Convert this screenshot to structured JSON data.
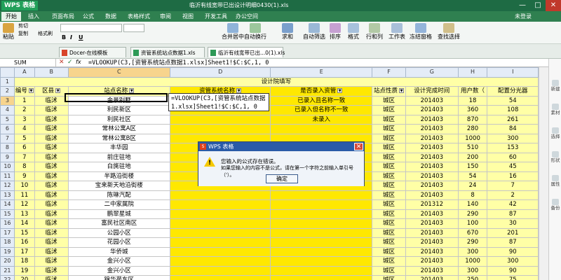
{
  "titlebar": {
    "app": "WPS 表格",
    "title": "临沂有线宽带已出设计明细0430(1).xls",
    "min": "—",
    "max": "□",
    "close": "✕"
  },
  "menubar": {
    "items": [
      "开始",
      "插入",
      "页面布局",
      "公式",
      "数据",
      "表格样式",
      "审阅",
      "视图",
      "开发工具",
      "办公空间"
    ],
    "active": 0,
    "login": "未登录"
  },
  "ribbon": {
    "paste": "粘贴",
    "cut": "剪切",
    "copy": "复制",
    "format_painter": "格式刷",
    "font": "",
    "size": "",
    "bold": "B",
    "italic": "I",
    "underline": "U",
    "merge": "合并居中",
    "wrap": "自动换行",
    "sum": "求和",
    "filter": "自动筛选",
    "sort": "排序",
    "format": "格式",
    "rowcol": "行和列",
    "sheet": "工作表",
    "freeze": "冻结窗格",
    "find": "查找选择"
  },
  "tabs": [
    {
      "label": "Docer-在线模板"
    },
    {
      "label": "资管系统站点数据1.xls"
    },
    {
      "label": "临沂有线宽带已出...0(1).xls"
    }
  ],
  "formula_bar": {
    "name": "SUM",
    "cancel": "✕",
    "ok": "✓",
    "fx": "fx",
    "formula": "=VLOOKUP(C3,[资管系统站点数据1.xlsx]Sheet1!$C:$C,1, 0"
  },
  "columns": [
    "A",
    "B",
    "C",
    "D",
    "E",
    "F",
    "G",
    "H",
    "I"
  ],
  "row1_header": "设计院填写",
  "header_row": [
    "编号",
    "区县",
    "站点名称",
    "资管系统名称",
    "是否录入资管",
    "站点性质",
    "设计完成时间",
    "用户数（",
    "配置分光器"
  ],
  "rows": [
    {
      "n": "3",
      "a": "1",
      "b": "临沭",
      "c": "金景别墅",
      "e": "已录入且名称一致",
      "f": "城区",
      "g": "201403",
      "h": "18",
      "i": "54"
    },
    {
      "n": "4",
      "a": "2",
      "b": "临沭",
      "c": "利民新区",
      "e": "已录入但名称不一致",
      "f": "城区",
      "g": "201403",
      "h": "360",
      "i": "108"
    },
    {
      "n": "5",
      "a": "3",
      "b": "临沭",
      "c": "利民社区",
      "e": "未录入",
      "f": "城区",
      "g": "201403",
      "h": "870",
      "i": "261"
    },
    {
      "n": "6",
      "a": "4",
      "b": "临沭",
      "c": "常林公寓A区",
      "e": "",
      "f": "城区",
      "g": "201403",
      "h": "280",
      "i": "84"
    },
    {
      "n": "7",
      "a": "5",
      "b": "临沭",
      "c": "常林公寓B区",
      "e": "",
      "f": "城区",
      "g": "201403",
      "h": "1000",
      "i": "300"
    },
    {
      "n": "8",
      "a": "6",
      "b": "临沭",
      "c": "丰华园",
      "e": "",
      "f": "城区",
      "g": "201403",
      "h": "510",
      "i": "153"
    },
    {
      "n": "9",
      "a": "7",
      "b": "临沭",
      "c": "前庄驻地",
      "e": "",
      "f": "城区",
      "g": "201403",
      "h": "200",
      "i": "60"
    },
    {
      "n": "10",
      "a": "8",
      "b": "临沭",
      "c": "白旄驻地",
      "e": "",
      "f": "城区",
      "g": "201403",
      "h": "150",
      "i": "45"
    },
    {
      "n": "11",
      "a": "9",
      "b": "临沭",
      "c": "半路沿街楼",
      "e": "",
      "f": "城区",
      "g": "201403",
      "h": "54",
      "i": "16"
    },
    {
      "n": "12",
      "a": "10",
      "b": "临沭",
      "c": "宝来新天地沿街楼",
      "e": "",
      "f": "城区",
      "g": "201403",
      "h": "24",
      "i": "7"
    },
    {
      "n": "13",
      "a": "11",
      "b": "临沭",
      "c": "陈琳汽配",
      "e": "",
      "f": "城区",
      "g": "201403",
      "h": "8",
      "i": "2"
    },
    {
      "n": "14",
      "a": "12",
      "b": "临沭",
      "c": "二中家属院",
      "e": "",
      "f": "城区",
      "g": "201312",
      "h": "140",
      "i": "42"
    },
    {
      "n": "15",
      "a": "13",
      "b": "临沭",
      "c": "鹏翠星城",
      "e": "",
      "f": "城区",
      "g": "201403",
      "h": "290",
      "i": "87"
    },
    {
      "n": "16",
      "a": "14",
      "b": "临沭",
      "c": "富民社区南区",
      "e": "",
      "f": "城区",
      "g": "201403",
      "h": "100",
      "i": "30"
    },
    {
      "n": "17",
      "a": "15",
      "b": "临沭",
      "c": "公园小区",
      "e": "",
      "f": "城区",
      "g": "201403",
      "h": "670",
      "i": "201"
    },
    {
      "n": "18",
      "a": "16",
      "b": "临沭",
      "c": "花园小区",
      "e": "",
      "f": "城区",
      "g": "201403",
      "h": "290",
      "i": "87"
    },
    {
      "n": "19",
      "a": "17",
      "b": "临沭",
      "c": "华侨城",
      "e": "",
      "f": "城区",
      "g": "201403",
      "h": "300",
      "i": "90"
    },
    {
      "n": "20",
      "a": "18",
      "b": "临沭",
      "c": "金兴小区",
      "e": "",
      "f": "城区",
      "g": "201403",
      "h": "1000",
      "i": "300"
    },
    {
      "n": "21",
      "a": "19",
      "b": "临沭",
      "c": "金兴小区",
      "e": "",
      "f": "城区",
      "g": "201403",
      "h": "300",
      "i": "90"
    },
    {
      "n": "22",
      "a": "20",
      "b": "临沭",
      "c": "锦华苑东区",
      "e": "",
      "f": "城区",
      "g": "201403",
      "h": "250",
      "i": "75"
    }
  ],
  "editing": {
    "line1": "=VLOOKUP(C3,[资管系统站点数据",
    "line2": "1.xlsx]Sheet1!$C:$C,1, 0"
  },
  "sidepanel": [
    "新建",
    "素材",
    "选择",
    "形状",
    "属性",
    "备份"
  ],
  "dialog": {
    "title": "WPS 表格",
    "close": "✕",
    "line1": "您输入的公式存在错误。",
    "line2": "如果您输入的内容不是公式，请在第一个字符之前输入单引号（'）。",
    "ok": "确定"
  }
}
